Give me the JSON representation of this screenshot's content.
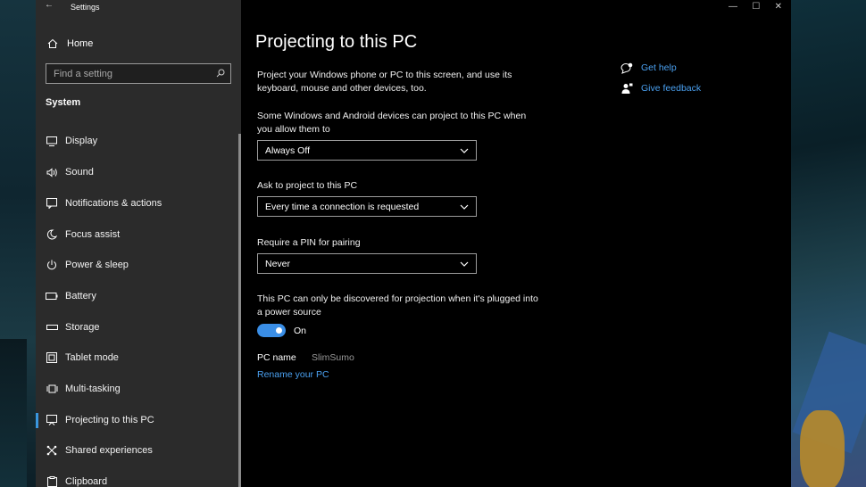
{
  "window": {
    "title": "Settings",
    "controls": {
      "minimize": "—",
      "maximize": "☐",
      "close": "✕"
    }
  },
  "sidebar": {
    "home_label": "Home",
    "search_placeholder": "Find a setting",
    "section_label": "System",
    "items": [
      {
        "label": "Display",
        "icon": "display-icon"
      },
      {
        "label": "Sound",
        "icon": "sound-icon"
      },
      {
        "label": "Notifications & actions",
        "icon": "notifications-icon"
      },
      {
        "label": "Focus assist",
        "icon": "moon-icon"
      },
      {
        "label": "Power & sleep",
        "icon": "power-icon"
      },
      {
        "label": "Battery",
        "icon": "battery-icon"
      },
      {
        "label": "Storage",
        "icon": "storage-icon"
      },
      {
        "label": "Tablet mode",
        "icon": "tablet-icon"
      },
      {
        "label": "Multi-tasking",
        "icon": "multitasking-icon"
      },
      {
        "label": "Projecting to this PC",
        "icon": "projecting-icon",
        "active": true
      },
      {
        "label": "Shared experiences",
        "icon": "shared-icon"
      },
      {
        "label": "Clipboard",
        "icon": "clipboard-icon"
      }
    ]
  },
  "main": {
    "title": "Projecting to this PC",
    "intro": "Project your Windows phone or PC to this screen, and use its keyboard, mouse and other devices, too.",
    "allow_label": "Some Windows and Android devices can project to this PC when you allow them to",
    "allow_value": "Always Off",
    "ask_label": "Ask to project to this PC",
    "ask_value": "Every time a connection is requested",
    "pin_label": "Require a PIN for pairing",
    "pin_value": "Never",
    "power_label": "This PC can only be discovered for projection when it's plugged into a power source",
    "power_toggle_state": "On",
    "pc_name_label": "PC name",
    "pc_name_value": "SlimSumo",
    "rename_link": "Rename your PC"
  },
  "help": {
    "get_help": "Get help",
    "give_feedback": "Give feedback"
  },
  "colors": {
    "accent": "#3a8ee6",
    "link": "#4aa0f0",
    "sidebar_bg": "#2b2b2b",
    "main_bg": "#000000"
  }
}
